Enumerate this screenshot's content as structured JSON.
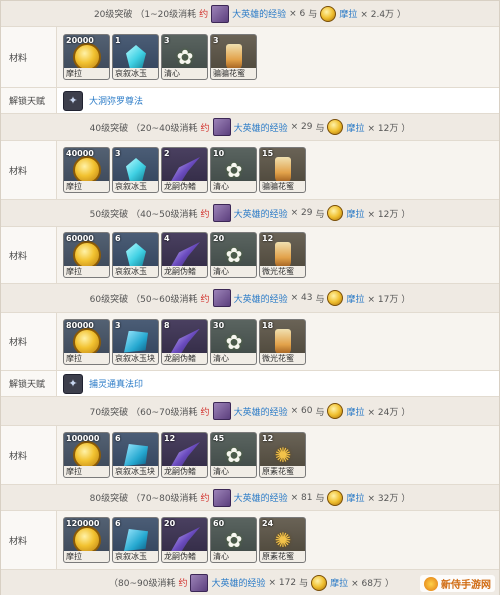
{
  "sections": [
    {
      "kind": "header",
      "level": "20级突破",
      "range": "（1~20级消耗",
      "approx": "约",
      "exp_item": "大英雄的经验",
      "exp_count": "× 6",
      "and": "与",
      "mora_item": "摩拉",
      "mora_count": "× 2.4万",
      "close": "）"
    },
    {
      "kind": "materials",
      "label": "材料",
      "items": [
        {
          "count": "20000",
          "name": "摩拉",
          "icon": "mora-coin",
          "bg": "bg-a"
        },
        {
          "count": "1",
          "name": "哀叙冰玉",
          "icon": "gem-sliver",
          "bg": "bg-b"
        },
        {
          "count": "3",
          "name": "清心",
          "icon": "flower",
          "bg": "bg-d"
        },
        {
          "count": "3",
          "name": "骗骗花蜜",
          "icon": "bottle",
          "bg": "bg-e"
        }
      ]
    },
    {
      "kind": "talent",
      "label": "解锁天赋",
      "name": "大洞弥罗尊法",
      "icon": "talent-icon"
    },
    {
      "kind": "header",
      "level": "40级突破",
      "range": "（20~40级消耗",
      "approx": "约",
      "exp_item": "大英雄的经验",
      "exp_count": "× 29",
      "and": "与",
      "mora_item": "摩拉",
      "mora_count": "× 12万",
      "close": "）"
    },
    {
      "kind": "materials",
      "label": "材料",
      "items": [
        {
          "count": "40000",
          "name": "摩拉",
          "icon": "mora-coin",
          "bg": "bg-a"
        },
        {
          "count": "3",
          "name": "哀叙冰玉",
          "icon": "gem-fragment",
          "bg": "bg-b"
        },
        {
          "count": "2",
          "name": "龙嗣伪鳍",
          "icon": "blade",
          "bg": "bg-c"
        },
        {
          "count": "10",
          "name": "清心",
          "icon": "flower",
          "bg": "bg-d"
        },
        {
          "count": "15",
          "name": "骗骗花蜜",
          "icon": "bottle",
          "bg": "bg-e"
        }
      ]
    },
    {
      "kind": "header",
      "level": "50级突破",
      "range": "（40~50级消耗",
      "approx": "约",
      "exp_item": "大英雄的经验",
      "exp_count": "× 29",
      "and": "与",
      "mora_item": "摩拉",
      "mora_count": "× 12万",
      "close": "）"
    },
    {
      "kind": "materials",
      "label": "材料",
      "items": [
        {
          "count": "60000",
          "name": "摩拉",
          "icon": "mora-coin",
          "bg": "bg-a"
        },
        {
          "count": "6",
          "name": "哀叙冰玉",
          "icon": "gem-fragment",
          "bg": "bg-b"
        },
        {
          "count": "4",
          "name": "龙嗣伪鳍",
          "icon": "blade",
          "bg": "bg-c"
        },
        {
          "count": "20",
          "name": "清心",
          "icon": "flower",
          "bg": "bg-d"
        },
        {
          "count": "12",
          "name": "微光花蜜",
          "icon": "bottle",
          "bg": "bg-e"
        }
      ]
    },
    {
      "kind": "header",
      "level": "60级突破",
      "range": "（50~60级消耗",
      "approx": "约",
      "exp_item": "大英雄的经验",
      "exp_count": "× 43",
      "and": "与",
      "mora_item": "摩拉",
      "mora_count": "× 17万",
      "close": "）"
    },
    {
      "kind": "materials",
      "label": "材料",
      "items": [
        {
          "count": "80000",
          "name": "摩拉",
          "icon": "mora-coin",
          "bg": "bg-a"
        },
        {
          "count": "3",
          "name": "哀叙冰玉块",
          "icon": "gem-chunk",
          "bg": "bg-b"
        },
        {
          "count": "8",
          "name": "龙嗣伪鳍",
          "icon": "blade",
          "bg": "bg-c"
        },
        {
          "count": "30",
          "name": "清心",
          "icon": "flower",
          "bg": "bg-d"
        },
        {
          "count": "18",
          "name": "微光花蜜",
          "icon": "bottle",
          "bg": "bg-e"
        }
      ]
    },
    {
      "kind": "talent",
      "label": "解锁天赋",
      "name": "捕灵通真法印",
      "icon": "talent-icon"
    },
    {
      "kind": "header",
      "level": "70级突破",
      "range": "（60~70级消耗",
      "approx": "约",
      "exp_item": "大英雄的经验",
      "exp_count": "× 60",
      "and": "与",
      "mora_item": "摩拉",
      "mora_count": "× 24万",
      "close": "）"
    },
    {
      "kind": "materials",
      "label": "材料",
      "items": [
        {
          "count": "100000",
          "name": "摩拉",
          "icon": "mora-coin",
          "bg": "bg-a"
        },
        {
          "count": "6",
          "name": "哀叙冰玉块",
          "icon": "gem-chunk",
          "bg": "bg-b"
        },
        {
          "count": "12",
          "name": "龙嗣伪鳍",
          "icon": "blade",
          "bg": "bg-c"
        },
        {
          "count": "45",
          "name": "清心",
          "icon": "flower",
          "bg": "bg-d"
        },
        {
          "count": "12",
          "name": "原素花蜜",
          "icon": "relic",
          "bg": "bg-e"
        }
      ]
    },
    {
      "kind": "header",
      "level": "80级突破",
      "range": "（70~80级消耗",
      "approx": "约",
      "exp_item": "大英雄的经验",
      "exp_count": "× 81",
      "and": "与",
      "mora_item": "摩拉",
      "mora_count": "× 32万",
      "close": "）"
    },
    {
      "kind": "materials",
      "label": "材料",
      "items": [
        {
          "count": "120000",
          "name": "摩拉",
          "icon": "mora-coin",
          "bg": "bg-a"
        },
        {
          "count": "6",
          "name": "哀叙冰玉",
          "icon": "gem-gemstone",
          "bg": "bg-b"
        },
        {
          "count": "20",
          "name": "龙嗣伪鳍",
          "icon": "blade",
          "bg": "bg-c"
        },
        {
          "count": "60",
          "name": "清心",
          "icon": "flower",
          "bg": "bg-d"
        },
        {
          "count": "24",
          "name": "原素花蜜",
          "icon": "relic",
          "bg": "bg-e"
        }
      ]
    },
    {
      "kind": "header",
      "level": "",
      "range": "（80~90级消耗",
      "approx": "约",
      "exp_item": "大英雄的经验",
      "exp_count": "× 172",
      "and": "与",
      "mora_item": "摩拉",
      "mora_count": "× 68万",
      "close": "）"
    }
  ],
  "watermark": {
    "text": "新侍手游网",
    "icon": "site-logo-icon"
  }
}
